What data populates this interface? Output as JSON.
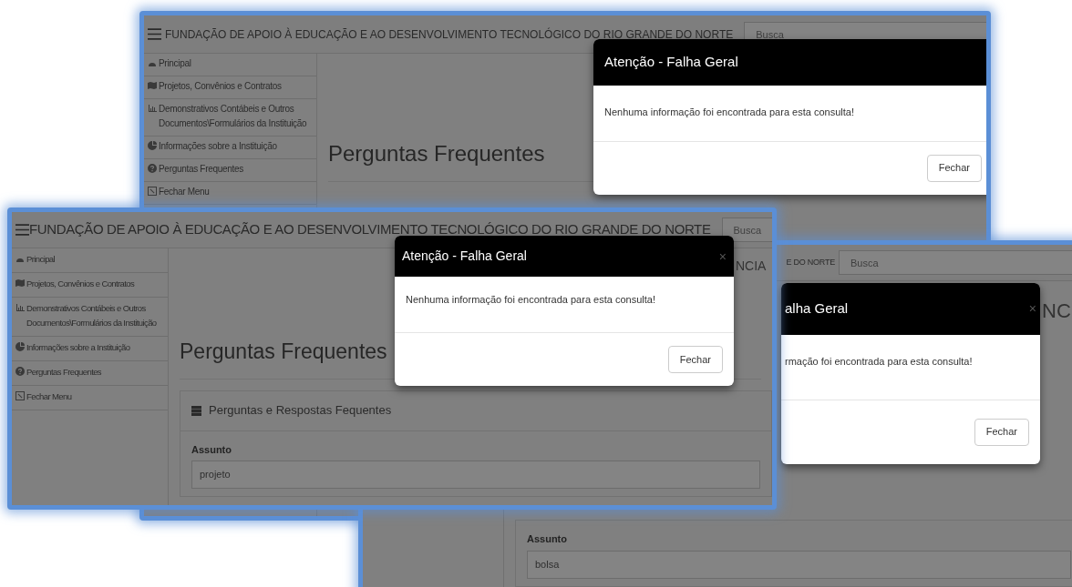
{
  "screenshots": [
    {
      "header": {
        "title": "FUNDAÇÃO DE APOIO À EDUCAÇÃO E AO DESENVOLVIMENTO TECNOLÓGICO DO RIO GRANDE DO NORTE",
        "search_placeholder": "Busca"
      },
      "sidebar": {
        "items": [
          "Principal",
          "Projetos, Convênios e Contratos",
          "Demonstrativos Contábeis e Outros Documentos\\Formulários da Instituição",
          "Informações sobre a Instituição",
          "Perguntas Frequentes",
          "Fechar Menu"
        ]
      },
      "heading": "Perguntas Frequentes",
      "modal": {
        "title": "Atenção - Falha Geral",
        "message": "Nenhuma informação foi encontrada para esta consulta!",
        "button": "Fechar"
      }
    },
    {
      "header": {
        "title": "FUNDAÇÃO DE APOIO À EDUCAÇÃO E AO DESENVOLVIMENTO TECNOLÓGICO DO RIO GRANDE DO NORTE",
        "search_placeholder": "Busca"
      },
      "sidebar": {
        "items": [
          "Principal",
          "Projetos, Convênios e Contratos",
          "Demonstrativos Contábeis e Outros Documentos\\Formulários da Instituição",
          "Informações sobre a Instituição",
          "Perguntas Frequentes",
          "Fechar Menu"
        ]
      },
      "heading": "Perguntas Frequentes",
      "banner": "NCIA",
      "panel": {
        "title": "Perguntas e Respostas Fequentes"
      },
      "field": {
        "label": "Assunto",
        "value": "projeto"
      },
      "modal": {
        "title": "Atenção - Falha Geral",
        "close": "×",
        "message": "Nenhuma informação foi encontrada para esta consulta!",
        "button": "Fechar"
      }
    },
    {
      "header": {
        "title": "E DO NORTE",
        "search_placeholder": "Busca"
      },
      "banner": "NC",
      "field": {
        "label": "Assunto",
        "value": "bolsa"
      },
      "modal": {
        "title": "alha Geral",
        "close": "×",
        "message": "rmação foi encontrada para esta consulta!",
        "button": "Fechar"
      }
    }
  ]
}
